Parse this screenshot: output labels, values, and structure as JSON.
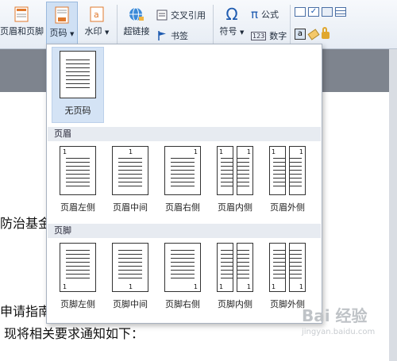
{
  "ribbon": {
    "header_footer_label": "页眉和页脚",
    "page_number_label": "页码",
    "watermark_label": "水印",
    "hyperlink_label": "超链接",
    "cross_reference_label": "交叉引用",
    "bookmark_label": "书签",
    "symbol_label": "符号",
    "formula_label": "公式",
    "number_label": "数字"
  },
  "dropdown": {
    "none_label": "无页码",
    "header_section": "页眉",
    "footer_section": "页脚",
    "header_items": [
      "页眉左侧",
      "页眉中间",
      "页眉右侧",
      "页眉内侧",
      "页眉外侧"
    ],
    "footer_items": [
      "页脚左侧",
      "页脚中间",
      "页脚右侧",
      "页脚内侧",
      "页脚外侧"
    ],
    "page_number_sample": "1"
  },
  "document": {
    "line1": "防治基金",
    "line2": "申请指南",
    "line3": "现将相关要求通知如下："
  },
  "watermark": {
    "logo_text": "Bai 经验",
    "url_text": "jingyan.baidu.com"
  }
}
